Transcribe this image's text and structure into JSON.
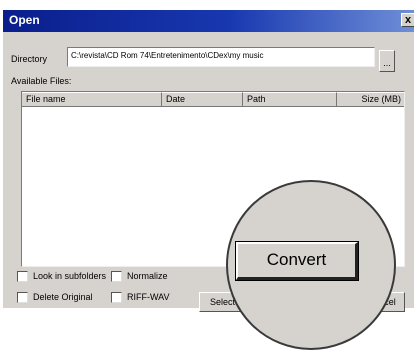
{
  "window": {
    "title": "Open",
    "close_label": "x"
  },
  "directory": {
    "label": "Directory",
    "value": "C:\\revista\\CD Rom 74\\Entretenimento\\CDex\\my music",
    "browse_label": "..."
  },
  "files": {
    "label": "Available Files:",
    "columns": [
      "File name",
      "Date",
      "Path",
      "Size (MB)"
    ]
  },
  "options": {
    "look_in_subfolders": "Look in subfolders",
    "normalize": "Normalize",
    "delete_original": "Delete Original",
    "riff_wav": "RIFF-WAV"
  },
  "buttons": {
    "select_all": "Select A",
    "convert": "Convert",
    "cancel": "ancel"
  }
}
